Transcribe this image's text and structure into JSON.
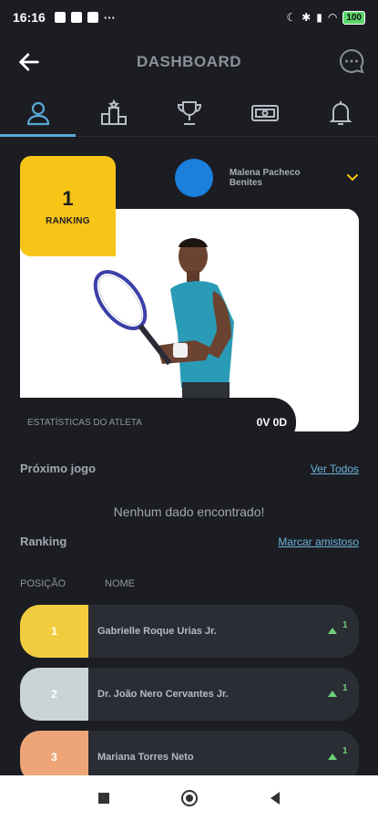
{
  "status": {
    "time": "16:16",
    "dots": "···",
    "battery": "100"
  },
  "header": {
    "title": "DASHBOARD"
  },
  "tabs": [
    {
      "name": "profile"
    },
    {
      "name": "podium"
    },
    {
      "name": "trophy"
    },
    {
      "name": "money"
    },
    {
      "name": "notifications"
    }
  ],
  "hero": {
    "rank_number": "1",
    "rank_label": "RANKING",
    "player_name": "Malena Pacheco Benites",
    "stats_label": "ESTATÍSTICAS DO ATLETA",
    "stats_value": "0V 0D"
  },
  "next_game": {
    "title": "Próximo jogo",
    "link": "Ver Todos",
    "empty": "Nenhum dado encontrado!"
  },
  "ranking": {
    "title": "Ranking",
    "link": "Marcar amistoso",
    "col_position": "POSIÇÃO",
    "col_name": "NOME",
    "rows": [
      {
        "pos": "1",
        "name": "Gabrielle Roque Urias Jr.",
        "change": "1",
        "color": "#f2cc3f"
      },
      {
        "pos": "2",
        "name": "Dr. João Nero Cervantes Jr.",
        "change": "1",
        "color": "#c9d4d7"
      },
      {
        "pos": "3",
        "name": "Mariana Torres Neto",
        "change": "1",
        "color": "#eda577"
      }
    ]
  },
  "colors": {
    "accent": "#5aa9d6",
    "rank_gold": "#f7c418",
    "background": "#1b1d22"
  }
}
